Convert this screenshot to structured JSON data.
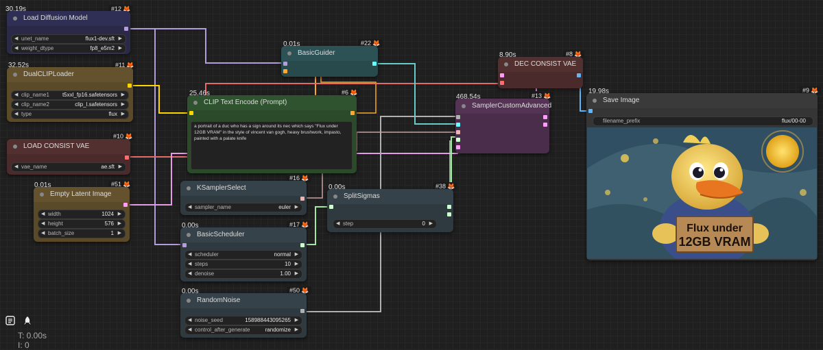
{
  "nodes": {
    "load_diffusion": {
      "title": "Load Diffusion Model",
      "time": "30.19s",
      "id": "#12",
      "widgets": [
        {
          "label": "unet_name",
          "value": "flux1-dev.sft"
        },
        {
          "label": "weight_dtype",
          "value": "fp8_e5m2"
        }
      ]
    },
    "dual_clip": {
      "title": "DualCLIPLoader",
      "time": "32.52s",
      "id": "#11",
      "widgets": [
        {
          "label": "clip_name1",
          "value": "t5xxl_fp16.safetensors"
        },
        {
          "label": "clip_name2",
          "value": "clip_l.safetensors"
        },
        {
          "label": "type",
          "value": "flux"
        }
      ]
    },
    "load_vae": {
      "title": "LOAD CONSIST VAE",
      "time": "",
      "id": "#10",
      "widgets": [
        {
          "label": "vae_name",
          "value": "ae.sft"
        }
      ]
    },
    "empty_latent": {
      "title": "Empty Latent Image",
      "time": "0.01s",
      "id": "#51",
      "widgets": [
        {
          "label": "width",
          "value": "1024"
        },
        {
          "label": "height",
          "value": "576"
        },
        {
          "label": "batch_size",
          "value": "1"
        }
      ]
    },
    "basic_guider": {
      "title": "BasicGuider",
      "time": "0.01s",
      "id": "#22"
    },
    "clip_text": {
      "title": "CLIP Text Encode (Prompt)",
      "time": "25.46s",
      "id": "#6",
      "text": "a portrait of a duc who has a sign around its nec which says \"Flux under 12GB VRAM\" in the style of vincent van gogh, heavy brushwork, impasto, painted with a palate knife"
    },
    "ksampler_select": {
      "title": "KSamplerSelect",
      "time": "",
      "id": "#16",
      "widgets": [
        {
          "label": "sampler_name",
          "value": "euler"
        }
      ]
    },
    "basic_scheduler": {
      "title": "BasicScheduler",
      "time": "0.00s",
      "id": "#17",
      "widgets": [
        {
          "label": "scheduler",
          "value": "normal"
        },
        {
          "label": "steps",
          "value": "10"
        },
        {
          "label": "denoise",
          "value": "1.00"
        }
      ]
    },
    "random_noise": {
      "title": "RandomNoise",
      "time": "0.00s",
      "id": "#50",
      "widgets": [
        {
          "label": "noise_seed",
          "value": "158988443095265"
        },
        {
          "label": "control_after_generate",
          "value": "randomize"
        }
      ]
    },
    "split_sigmas": {
      "title": "SplitSigmas",
      "time": "0.00s",
      "id": "#38",
      "widgets": [
        {
          "label": "step",
          "value": "0"
        }
      ]
    },
    "sampler_custom": {
      "title": "SamplerCustomAdvanced",
      "time": "468.54s",
      "id": "#13"
    },
    "dec_vae": {
      "title": "DEC CONSIST VAE",
      "time": "8.90s",
      "id": "#8"
    },
    "save_image": {
      "title": "Save Image",
      "time": "19.98s",
      "id": "#9",
      "widgets": [
        {
          "label": "filename_prefix",
          "value": "flux/00-00"
        }
      ],
      "image_sign_line1": "Flux under",
      "image_sign_line2": "12GB VRAM"
    }
  },
  "status": {
    "t": "T: 0.00s",
    "i": "I: 0"
  },
  "icons": {
    "fox": "fox-icon",
    "queue": "queue-list-icon",
    "rocket": "rocket-icon"
  },
  "colors": {
    "clip": "#ffd500",
    "model": "#b39ddb",
    "vae": "#ff6e6e",
    "latent": "#ff9cf9",
    "conditioning": "#ffa931",
    "guider": "#66ffff",
    "sampler": "#ecb4b4",
    "sigmas": "#cdffcd",
    "noise": "#b0b0b0"
  }
}
